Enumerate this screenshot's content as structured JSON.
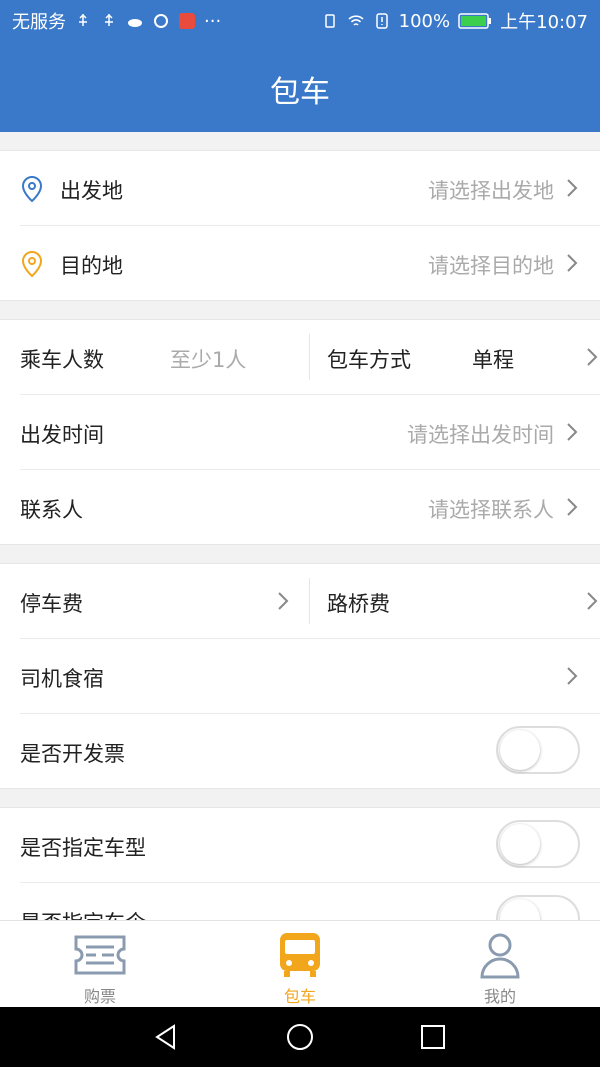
{
  "status_bar": {
    "carrier": "无服务",
    "battery": "100%",
    "time": "上午10:07",
    "more": "···"
  },
  "header": {
    "title": "包车"
  },
  "route": {
    "origin": {
      "label": "出发地",
      "placeholder": "请选择出发地",
      "icon": "location-pin-blue-icon"
    },
    "destination": {
      "label": "目的地",
      "placeholder": "请选择目的地",
      "icon": "location-pin-orange-icon"
    }
  },
  "trip": {
    "passengers": {
      "label": "乘车人数",
      "placeholder": "至少1人"
    },
    "mode": {
      "label": "包车方式",
      "value": "单程"
    },
    "departure_time": {
      "label": "出发时间",
      "placeholder": "请选择出发时间"
    },
    "contact": {
      "label": "联系人",
      "placeholder": "请选择联系人"
    }
  },
  "fees": {
    "parking": {
      "label": "停车费"
    },
    "toll": {
      "label": "路桥费"
    },
    "driver_meals": {
      "label": "司机食宿"
    },
    "invoice": {
      "label": "是否开发票",
      "enabled": false
    }
  },
  "vehicle": {
    "specify_type": {
      "label": "是否指定车型",
      "enabled": false
    },
    "specify_company": {
      "label": "是否指定车企",
      "enabled": false
    }
  },
  "tabs": [
    {
      "label": "购票",
      "icon": "ticket-icon",
      "active": false
    },
    {
      "label": "包车",
      "icon": "bus-icon",
      "active": true
    },
    {
      "label": "我的",
      "icon": "person-icon",
      "active": false
    }
  ],
  "colors": {
    "primary": "#3a78c9",
    "accent": "#f2a61c",
    "placeholder": "#aaaaaa"
  }
}
